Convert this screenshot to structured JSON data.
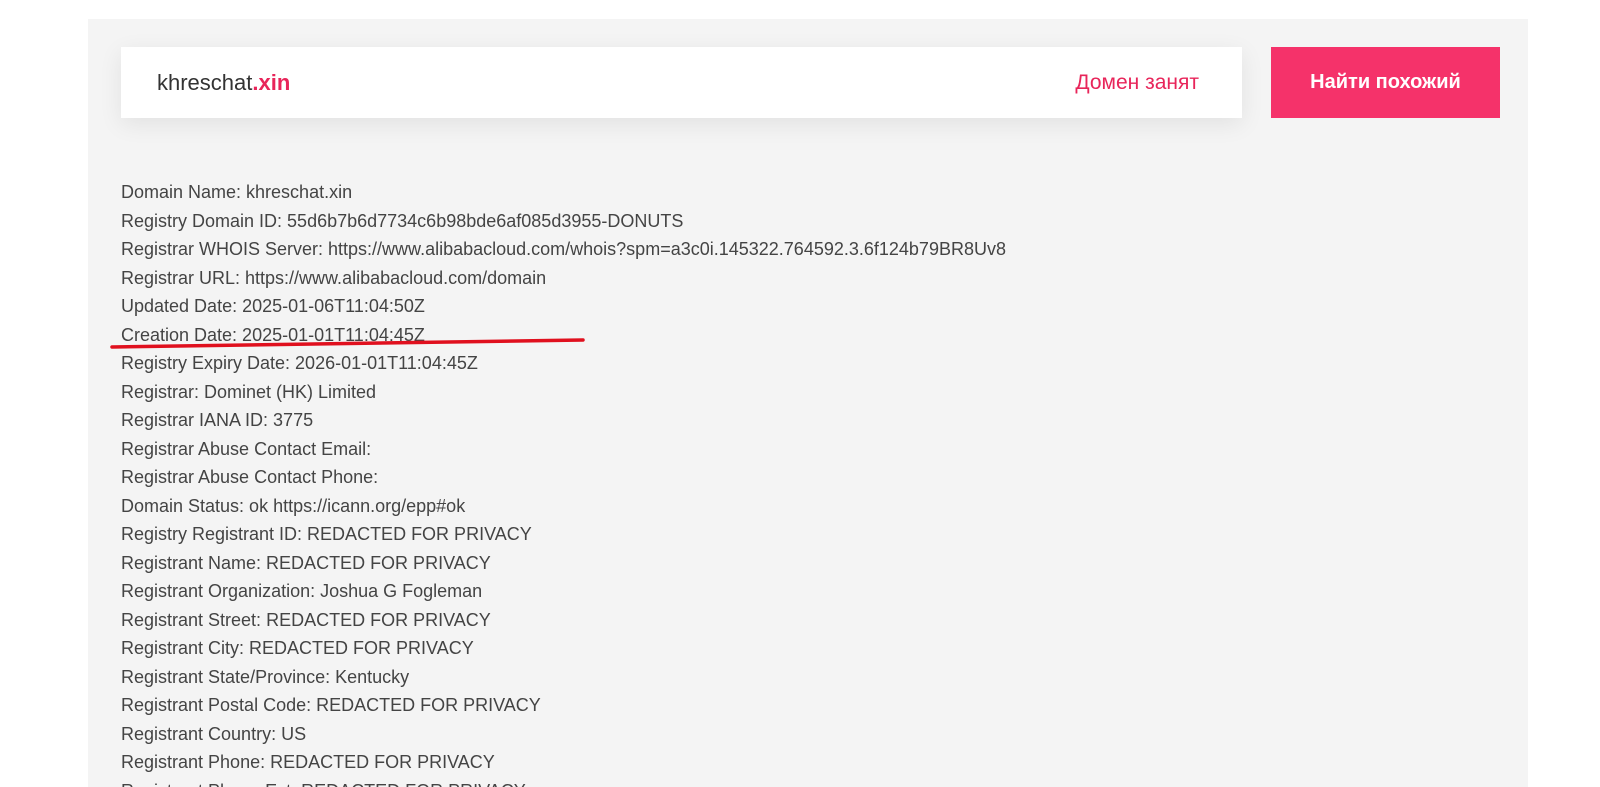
{
  "search": {
    "domain_name": "khreschat",
    "domain_tld": ".xin",
    "status": "Домен занят",
    "button_label": "Найти похожий"
  },
  "colors": {
    "accent": "#e8255a",
    "button_bg": "#f5326a",
    "panel_bg": "#f4f4f4",
    "annotation": "#e0101e"
  },
  "whois_lines": [
    "Domain Name: khreschat.xin",
    "Registry Domain ID: 55d6b7b6d7734c6b98bde6af085d3955-DONUTS",
    "Registrar WHOIS Server: https://www.alibabacloud.com/whois?spm=a3c0i.145322.764592.3.6f124b79BR8Uv8",
    "Registrar URL: https://www.alibabacloud.com/domain",
    "Updated Date: 2025-01-06T11:04:50Z",
    "Creation Date: 2025-01-01T11:04:45Z",
    "Registry Expiry Date: 2026-01-01T11:04:45Z",
    "Registrar: Dominet (HK) Limited",
    "Registrar IANA ID: 3775",
    "Registrar Abuse Contact Email:",
    "Registrar Abuse Contact Phone:",
    "Domain Status: ok https://icann.org/epp#ok",
    "Registry Registrant ID: REDACTED FOR PRIVACY",
    "Registrant Name: REDACTED FOR PRIVACY",
    "Registrant Organization: Joshua G Fogleman",
    "Registrant Street: REDACTED FOR PRIVACY",
    "Registrant City: REDACTED FOR PRIVACY",
    "Registrant State/Province: Kentucky",
    "Registrant Postal Code: REDACTED FOR PRIVACY",
    "Registrant Country: US",
    "Registrant Phone: REDACTED FOR PRIVACY",
    "Registrant Phone Ext: REDACTED FOR PRIVACY"
  ]
}
